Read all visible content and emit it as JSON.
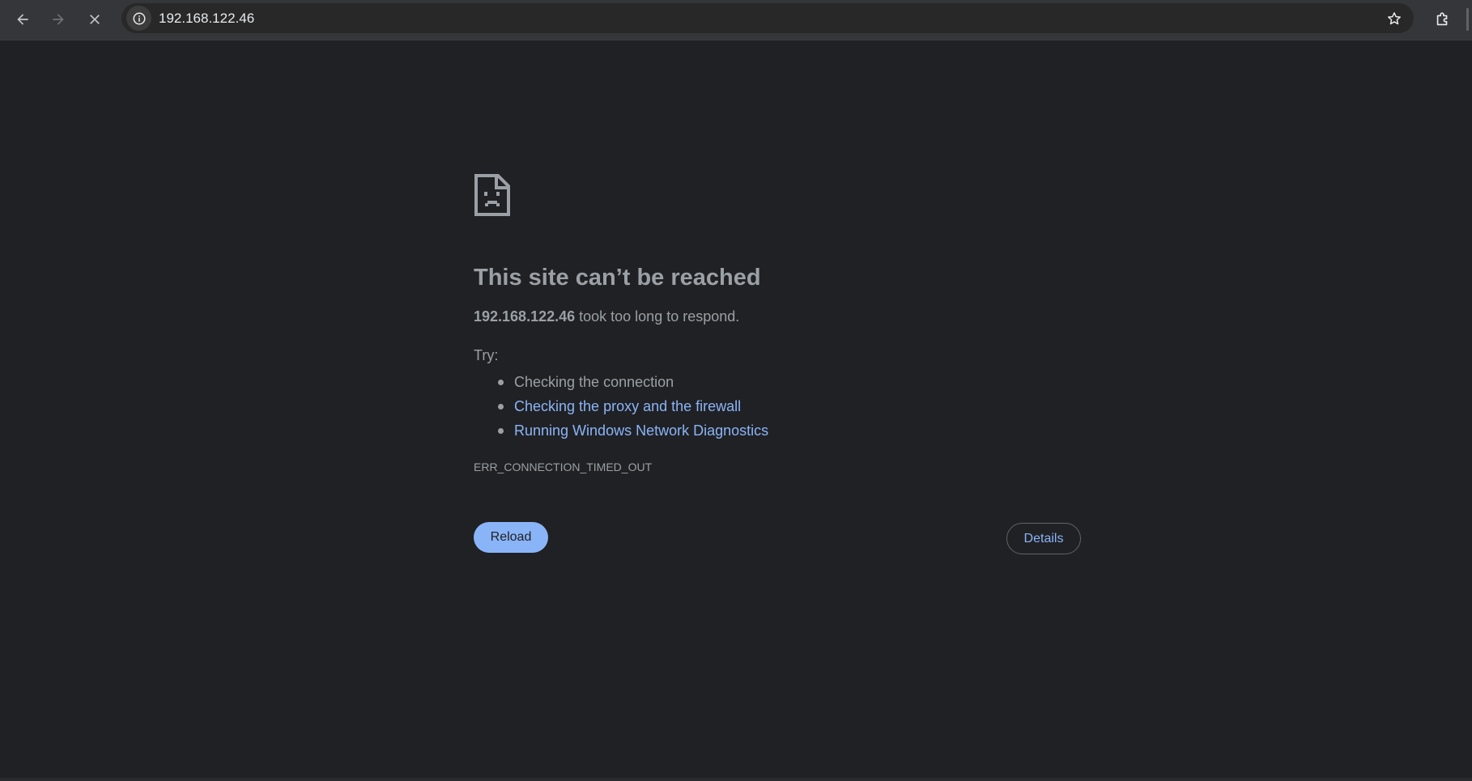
{
  "toolbar": {
    "back_icon": "arrow-left-icon",
    "forward_icon": "arrow-right-icon",
    "stop_icon": "close-icon",
    "url": "192.168.122.46",
    "site_info_icon": "info-icon",
    "bookmark_icon": "star-icon",
    "extensions_icon": "puzzle-icon"
  },
  "error_page": {
    "icon": "sad-document-icon",
    "heading": "This site can’t be reached",
    "host": "192.168.122.46",
    "summary_rest": " took too long to respond.",
    "try_label": "Try:",
    "suggestions": [
      {
        "text": "Checking the connection",
        "link": false
      },
      {
        "text": "Checking the proxy and the firewall",
        "link": true
      },
      {
        "text": "Running Windows Network Diagnostics",
        "link": true
      }
    ],
    "error_code": "ERR_CONNECTION_TIMED_OUT",
    "reload_label": "Reload",
    "details_label": "Details"
  },
  "colors": {
    "background": "#202124",
    "text": "#9aa0a6",
    "link": "#8ab4f8",
    "primary_button": "#8ab4f8"
  }
}
